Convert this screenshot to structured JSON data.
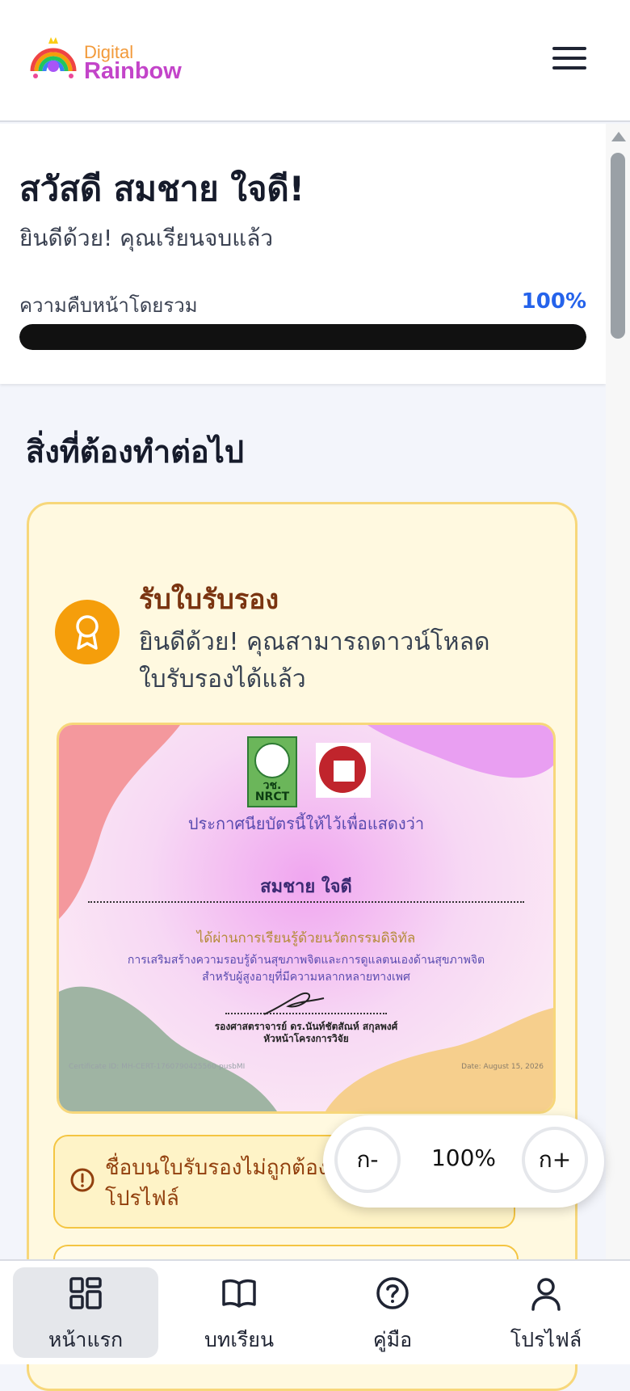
{
  "brand": {
    "line1": "Digital",
    "line2": "Rainbow"
  },
  "header": {
    "menu_icon": "hamburger-icon"
  },
  "welcome": {
    "greeting": "สวัสดี สมชาย ใจดี!",
    "subtitle": "ยินดีด้วย! คุณเรียนจบแล้ว",
    "progress_label": "ความคืบหน้าโดยรวม",
    "progress_text": "100%",
    "progress_value": 100
  },
  "next_steps": {
    "title": "สิ่งที่ต้องทำต่อไป"
  },
  "certificate_card": {
    "title": "รับใบรับรอง",
    "description": "ยินดีด้วย! คุณสามารถดาวน์โหลดใบรับรองได้แล้ว",
    "icon": "award-icon",
    "accent_color": "#f59e0b"
  },
  "certificate": {
    "nrct_label": "วช.",
    "nrct_sub": "NRCT",
    "line1": "ประกาศนียบัตรนี้ให้ไว้เพื่อแสดงว่า",
    "name": "สมชาย ใจดี",
    "line2": "ได้ผ่านการเรียนรู้ด้วยนวัตกรรมดิจิทัล",
    "line3a": "การเสริมสร้างความรอบรู้ด้านสุขภาพจิตและการดูแลตนเองด้านสุขภาพจิต",
    "line3b": "สำหรับผู้สูงอายุที่มีความหลากหลายทางเพศ",
    "signer_name": "รองศาสตราจารย์ ดร.นันท์ชัตสัณห์ สกุลพงศ์",
    "signer_title": "หัวหน้าโครงการวิจัย",
    "id_text": "Certificate ID: MH-CERT-1760790425560-pusbMI",
    "date_text": "Date: August 15, 2026"
  },
  "warning": {
    "text": "ชื่อบนใบรับรองไม่ถูกต้อง? แก้ไขได้ที่โปรไฟล์",
    "icon": "alert-circle-icon"
  },
  "zoom": {
    "minus": "ก-",
    "value": "100%",
    "plus": "ก+"
  },
  "bottom_nav": {
    "items": [
      {
        "label": "หน้าแรก",
        "icon": "grid-icon"
      },
      {
        "label": "บทเรียน",
        "icon": "book-icon"
      },
      {
        "label": "คู่มือ",
        "icon": "help-circle-icon"
      },
      {
        "label": "โปรไฟล์",
        "icon": "user-icon"
      }
    ]
  }
}
